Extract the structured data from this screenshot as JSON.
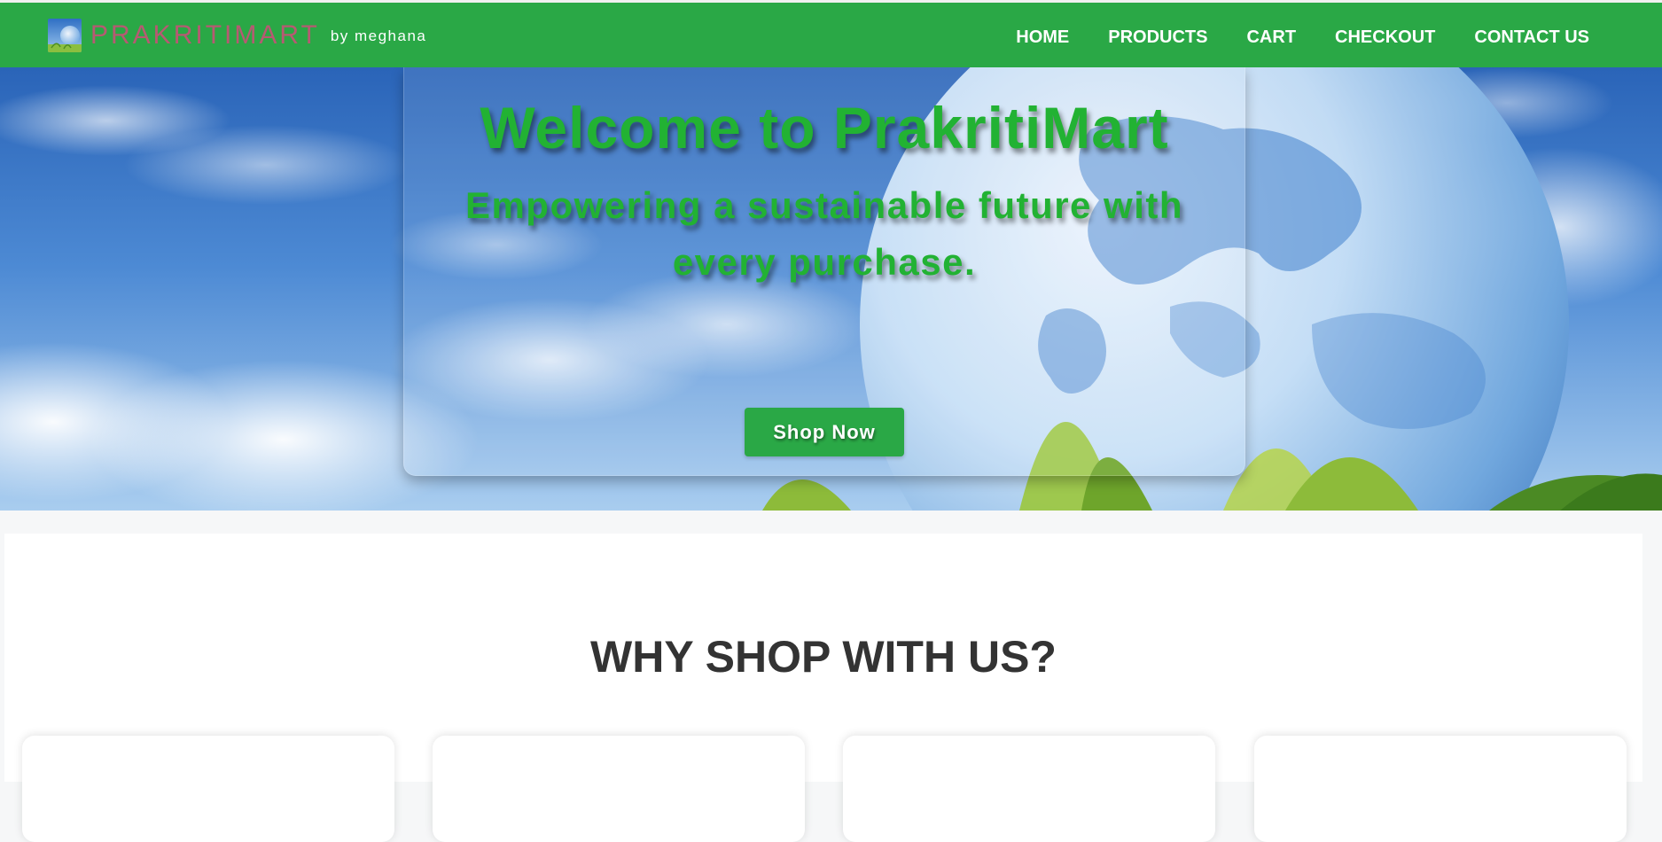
{
  "navbar": {
    "brand_name": "PRAKRITIMART",
    "brand_tagline": "by meghana",
    "brand_logo_icon": "globe-landscape-icon",
    "links": [
      {
        "label": "HOME"
      },
      {
        "label": "PRODUCTS"
      },
      {
        "label": "CART"
      },
      {
        "label": "CHECKOUT"
      },
      {
        "label": "CONTACT US"
      }
    ],
    "colors": {
      "background": "#2aa846",
      "brand_text": "#b65a72",
      "link_text": "#ffffff"
    }
  },
  "hero": {
    "title": "Welcome to PrakritiMart",
    "subtitle": "Empowering a sustainable future with every purchase.",
    "cta_label": "Shop Now",
    "background_icon": "globe-sky-grass-image",
    "colors": {
      "heading": "#22b233",
      "button": "#2aa846"
    }
  },
  "why_section": {
    "title": "WHY SHOP WITH US?",
    "title_color": "#333333"
  }
}
